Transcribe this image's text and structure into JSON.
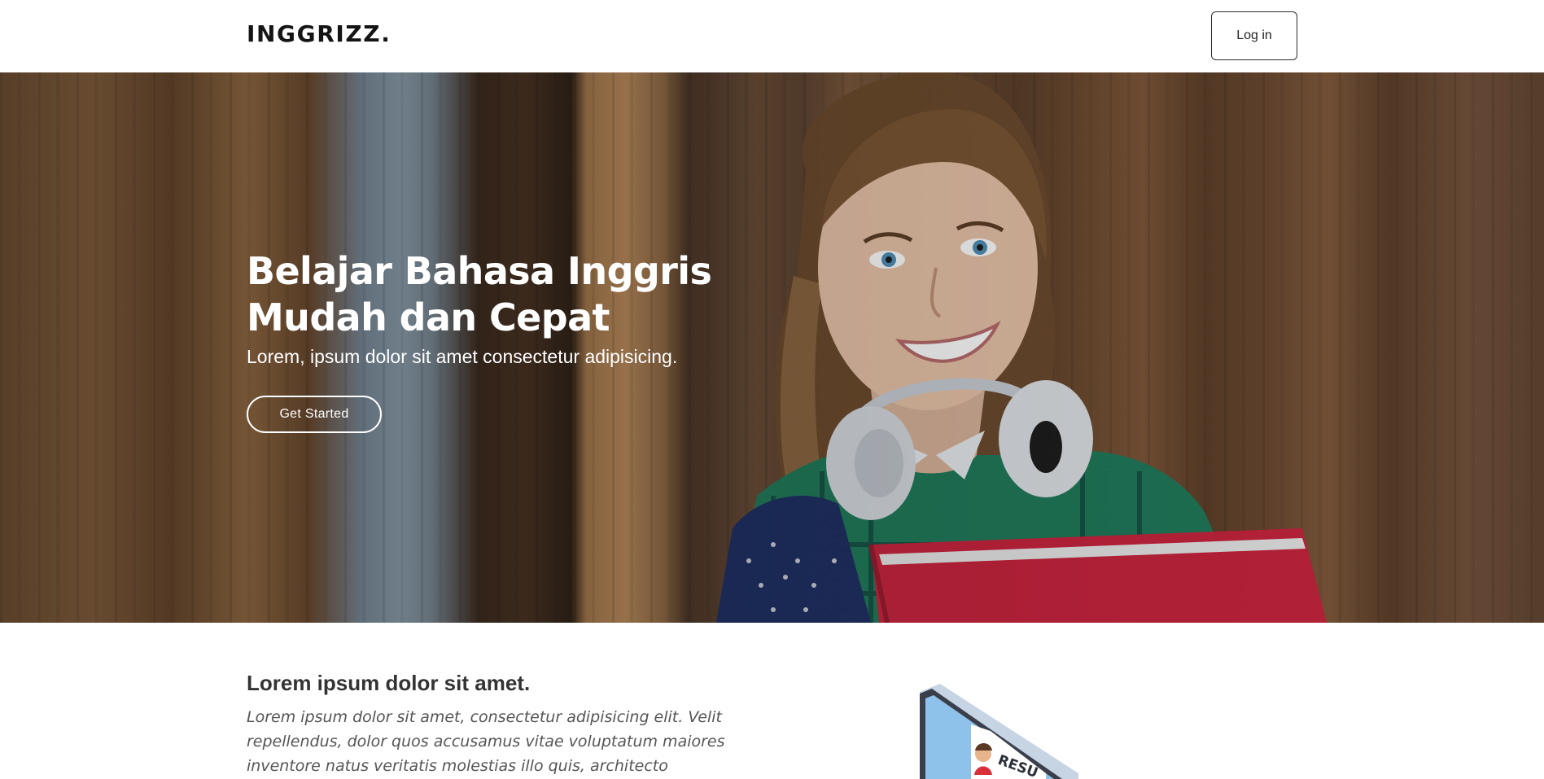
{
  "navbar": {
    "brand": "INGGRIZZ.",
    "login_label": "Log in"
  },
  "hero": {
    "title_line1": "Belajar Bahasa Inggris",
    "title_line2": "Mudah dan Cepat",
    "subtitle": "Lorem, ipsum dolor sit amet consectetur adipisicing.",
    "cta_label": "Get Started"
  },
  "section": {
    "title": "Lorem ipsum dolor sit amet.",
    "text": "Lorem ipsum dolor sit amet, consectetur adipisicing elit. Velit repellendus, dolor quos accusamus vitae voluptatum maiores inventore natus veritatis molestias illo quis, architecto recusandae",
    "illustration_label": "RESU"
  },
  "colors": {
    "navbar_bg": "#ffffff",
    "text_dark": "#141414",
    "hero_text": "#ffffff",
    "folder_red": "#c8233d",
    "shirt_green": "#1f7a5a"
  },
  "icons": {
    "hero_image": "student-girl-photo",
    "illustration": "resume-monitor-illustration"
  }
}
